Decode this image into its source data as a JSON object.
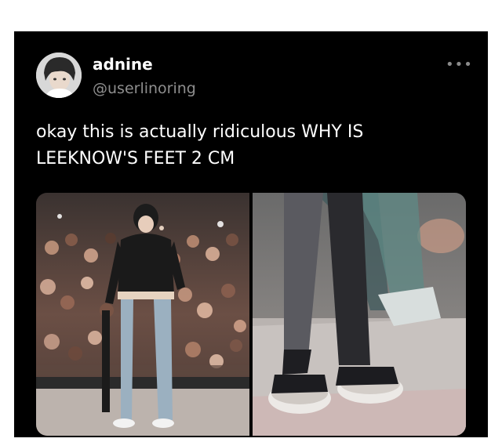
{
  "tweet": {
    "display_name": "adnine",
    "handle": "@userlinoring",
    "text_line1": "okay this is actually ridiculous WHY IS",
    "text_line2": "LEEKNOW'S FEET 2 CM",
    "more_label": "•••"
  },
  "colors": {
    "card_bg": "#000000",
    "name": "#ffffff",
    "handle": "#8e8e8e",
    "text": "#ffffff"
  },
  "icons": {
    "more": "more-horizontal-icon",
    "avatar": "user-avatar"
  },
  "media": {
    "left_photo": "concert-crowd-performer-photo",
    "right_photo": "closeup-feet-on-stage-photo"
  }
}
